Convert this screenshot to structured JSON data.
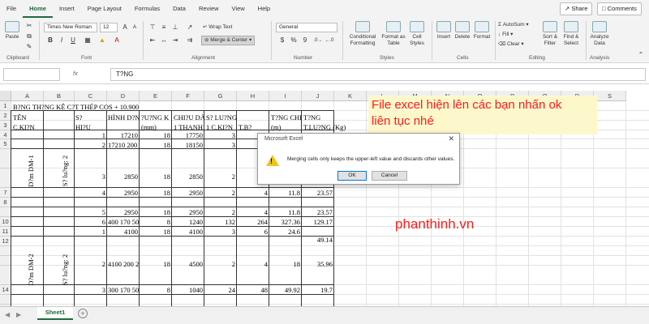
{
  "ribbon_tabs": [
    "File",
    "Home",
    "Insert",
    "Page Layout",
    "Formulas",
    "Data",
    "Review",
    "View",
    "Help"
  ],
  "active_tab": "Home",
  "share_label": "Share",
  "comments_label": "Comments",
  "clipboard": {
    "paste": "Paste",
    "label": "Clipboard"
  },
  "font": {
    "name": "Times New Roman",
    "size": "12",
    "bold": "B",
    "italic": "I",
    "underline": "U",
    "label": "Font"
  },
  "alignment": {
    "wrap": "Wrap Text",
    "merge": "Merge & Center",
    "label": "Alignment"
  },
  "number": {
    "format": "General",
    "currency": "$",
    "percent": "%",
    "comma": "9",
    "label": "Number"
  },
  "styles": {
    "conditional": "Conditional Formatting",
    "format_as_table": "Format as Table",
    "cell_styles": "Cell Styles",
    "label": "Styles"
  },
  "cells": {
    "insert": "Insert",
    "delete": "Delete",
    "format": "Format",
    "label": "Cells"
  },
  "editing": {
    "autosum": "AutoSum",
    "fill": "Fill",
    "clear": "Clear",
    "sort": "Sort & Filter",
    "find": "Find & Select",
    "label": "Editing"
  },
  "analysis": {
    "analyze": "Analyze Data",
    "label": "Analysis"
  },
  "formula_bar": {
    "fx": "fx",
    "content": "T?NG"
  },
  "columns": [
    "A",
    "B",
    "C",
    "D",
    "E",
    "F",
    "G",
    "H",
    "I",
    "J",
    "K",
    "L",
    "M",
    "N",
    "O",
    "P",
    "Q",
    "R",
    "S"
  ],
  "rows": [
    "1",
    "2",
    "3",
    "4",
    "5",
    "",
    "",
    "7",
    "8",
    "",
    "10",
    "11",
    "12",
    "",
    "",
    "",
    "14",
    "",
    "16",
    "17"
  ],
  "cells_text": {
    "r1a": "B?NG TH?NG KÊ C?T THÉP COS + 10.900",
    "r2a": "TÊN",
    "r2c": "S?",
    "r2d": "HÌNH D?N",
    "r2e": "?U?NG K",
    "r2f": "CHI?U DÀ",
    "r2g": "S? LU?NG",
    "r2i": "T?NG CHI",
    "r2j": "T?NG",
    "r3a": "C.KI?N",
    "r3c": "HI?U",
    "r3e": "(mm)",
    "r3f": "1 THANH",
    "r3g": "1 C.KI?N",
    "r3h": "T.B?",
    "r3i": "(m)",
    "r3j": "T.LU?NG (Kg)",
    "r4c": "1",
    "r4d": "17210",
    "r4e": "18",
    "r4f": "17750",
    "r4g": "3",
    "r5c": "2",
    "r5d": "17210 200",
    "r5e": "18",
    "r5f": "18150",
    "r5g": "3",
    "r7c": "3",
    "r7d": "2850",
    "r7e": "18",
    "r7f": "2850",
    "r7g": "2",
    "r8c": "4",
    "r8d": "2950",
    "r8e": "18",
    "r8f": "2950",
    "r8g": "2",
    "r8h": "4",
    "r8i": "11.8",
    "r8j": "23.57",
    "r10c": "5",
    "r10d": "2950",
    "r10e": "18",
    "r10f": "2950",
    "r10g": "2",
    "r10h": "4",
    "r10i": "11.8",
    "r10j": "23.57",
    "r11c": "6",
    "r11d": "400 170 50",
    "r11e": "8",
    "r11f": "1240",
    "r11g": "132",
    "r11h": "264",
    "r11i": "327.36",
    "r11j": "129.17",
    "r12c": "1",
    "r12d": "4100",
    "r12e": "18",
    "r12f": "4100",
    "r12g": "3",
    "r12h": "6",
    "r12i": "24.6",
    "r12j": "49.14",
    "r14c": "2",
    "r14d": "4100 200 2",
    "r14e": "18",
    "r14f": "4500",
    "r14g": "2",
    "r14h": "4",
    "r14i": "18",
    "r14j": "35.96",
    "r16c": "3",
    "r16d": "300 170 50",
    "r16e": "8",
    "r16f": "1040",
    "r16g": "24",
    "r16h": "48",
    "r16i": "49.92",
    "r16j": "19.7",
    "vert_a1": "D?m DM-1",
    "vert_b1": "S? lu?ng: 2",
    "vert_a2": "D?m DM-2",
    "vert_b2": "S? lu?ng: 2"
  },
  "annotation": {
    "line1": "File excel hiện lên các bạn nhấn ok",
    "line2": "liên tục nhé"
  },
  "watermark": "phanthinh.vn",
  "dialog": {
    "title": "Microsoft Excel",
    "message": "Merging cells only keeps the upper-left value and discards other values.",
    "ok": "OK",
    "cancel": "Cancel"
  },
  "sheet_tab": "Sheet1"
}
